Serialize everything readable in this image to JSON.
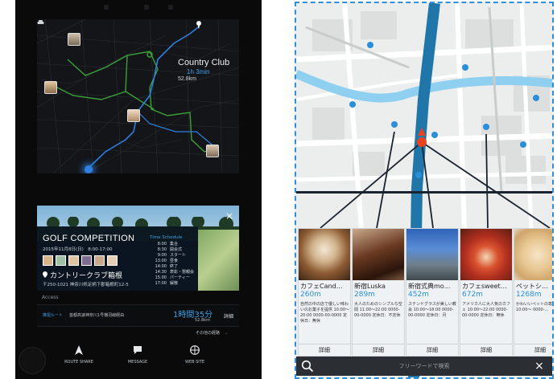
{
  "left_screen": {
    "map": {
      "destination": {
        "name": "Country Club",
        "eta": "1h 3min",
        "distance": "52.8km"
      }
    },
    "event_card": {
      "title": "GOLF COMPETITION",
      "date": "2015年11月8日(日)　8:00-17:00",
      "place": "カントリークラブ箱根",
      "address": "〒250-1021 神奈川県足柄下郡箱根町12-5",
      "schedule_title": "Time Schedule",
      "schedule": [
        {
          "time": "8:00",
          "label": "集合"
        },
        {
          "time": "8:30",
          "label": "開会式"
        },
        {
          "time": "9:00",
          "label": "スタート"
        },
        {
          "time": "13:00",
          "label": "昼食"
        },
        {
          "time": "14:00",
          "label": "終了"
        },
        {
          "time": "14:30",
          "label": "表彰・懇親会"
        },
        {
          "time": "15:00",
          "label": "パーティー"
        },
        {
          "time": "17:00",
          "label": "解散"
        }
      ],
      "close_label": "×"
    },
    "access": {
      "label": "Access",
      "route_kind": "推奨ルート",
      "route_desc": "首都高速神奈川1号横羽線経由",
      "duration": "1時間35分",
      "distance": "52.8km",
      "detail_label": "詳細",
      "other_routes": "その他の経路"
    },
    "nav": [
      {
        "label": "ROUTE SHARE",
        "icon": "navigation-arrow-icon"
      },
      {
        "label": "MESSAGE",
        "icon": "chat-bubble-icon"
      },
      {
        "label": "WEB SITE",
        "icon": "globe-icon"
      }
    ]
  },
  "right_screen": {
    "pois": [
      {
        "name": "カフェCand…",
        "distance": "260m",
        "desc": "自然の中の店で優しい味わいのお菓子を提供 10:00〜20:00 0000-00-0000 定休日：無休",
        "photo": "latte-cup",
        "detail": "詳細"
      },
      {
        "name": "新宿Luska",
        "distance": "289m",
        "desc": "大人のためのシンプルな空間 11:00〜22:00 0000-00-0000 定休日：不定休",
        "photo": "chocolate-dessert",
        "detail": "詳細"
      },
      {
        "name": "新宿式典mo…",
        "distance": "452m",
        "desc": "ステンドグラスが美しい教会 10:00〜18:00 0000-00-0000 定休日：月",
        "photo": "cathedral",
        "detail": "詳細"
      },
      {
        "name": "カフェsweet…",
        "distance": "672m",
        "desc": "アメリカ人に大人気のカフェ 10:00〜22:00 0000-00-0000 定休日：無休",
        "photo": "fruit-cake",
        "detail": "詳細"
      },
      {
        "name": "ペットシ…",
        "distance": "1268m",
        "desc": "かわいいペットの専門店 10:00〜 0000-…",
        "photo": "pomeranian-dog",
        "detail": "詳細"
      }
    ],
    "search": {
      "placeholder": "フリーワードで検索"
    },
    "clear_label": "×"
  },
  "colors": {
    "accent_blue": "#3ea0e6",
    "route_green": "#3aa13a",
    "river_blue": "#8fd0f0",
    "road_blue": "#2076a8",
    "current_location": "#e8431e"
  }
}
